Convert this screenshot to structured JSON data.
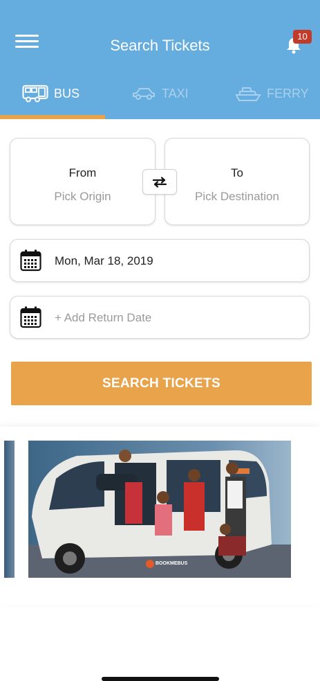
{
  "header": {
    "title": "Search Tickets",
    "notification_count": "10"
  },
  "tabs": [
    {
      "label": "BUS",
      "icon": "bus-icon",
      "active": true
    },
    {
      "label": "TAXI",
      "icon": "taxi-icon",
      "active": false
    },
    {
      "label": "FERRY",
      "icon": "ferry-icon",
      "active": false
    }
  ],
  "route": {
    "from_label": "From",
    "from_placeholder": "Pick Origin",
    "to_label": "To",
    "to_placeholder": "Pick Destination"
  },
  "dates": {
    "departure": "Mon, Mar 18, 2019",
    "return_placeholder": "+ Add Return Date"
  },
  "search_button": "SEARCH TICKETS",
  "promo": {
    "brand": "BOOKMEBUS"
  },
  "colors": {
    "header": "#65addf",
    "accent": "#e9a44b",
    "badge": "#c23a2a"
  }
}
